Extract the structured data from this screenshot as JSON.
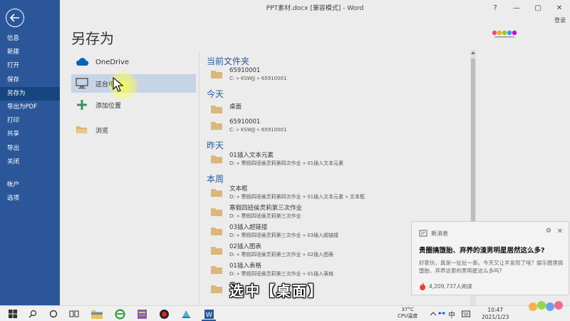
{
  "window": {
    "title": "PPT素材.docx [兼容模式] - Word",
    "controls": [
      "?",
      "—",
      "▢",
      "✕"
    ],
    "login": "登录"
  },
  "sidebar": {
    "items": [
      {
        "label": "信息"
      },
      {
        "label": "新建"
      },
      {
        "label": "打开"
      },
      {
        "label": "保存"
      },
      {
        "label": "另存为",
        "active": true
      },
      {
        "label": "导出为PDF"
      },
      {
        "label": "打印"
      },
      {
        "label": "共享"
      },
      {
        "label": "导出"
      },
      {
        "label": "关闭"
      },
      {
        "label": "帐户"
      },
      {
        "label": "选项"
      }
    ]
  },
  "page": {
    "title": "另存为"
  },
  "locations": [
    {
      "label": "OneDrive",
      "icon": "cloud-icon"
    },
    {
      "label": "这台电脑",
      "icon": "computer-icon",
      "selected": true
    },
    {
      "label": "添加位置",
      "icon": "plus-icon"
    },
    {
      "label": "浏览",
      "icon": "folder-open-icon"
    }
  ],
  "recent": {
    "sections": [
      {
        "title": "当前文件夹",
        "entries": [
          {
            "name": "65910001",
            "path": "C: » KSWJJ » 65910001"
          }
        ]
      },
      {
        "title": "今天",
        "entries": [
          {
            "name": "桌面",
            "path": ""
          },
          {
            "name": "65910001",
            "path": "C: » KSWJJ » 65910001"
          }
        ]
      },
      {
        "title": "昨天",
        "entries": [
          {
            "name": "01插入文本元素",
            "path": "D: » 寒假四班侯灵莉第四次作业 » 01插入文本元素"
          }
        ]
      },
      {
        "title": "本周",
        "entries": [
          {
            "name": "文本框",
            "path": "D: » 寒假四班侯灵莉第四次作业 » 01插入文本元素 » 文本框"
          },
          {
            "name": "寒假四班侯灵莉第三次作业",
            "path": "D: » 寒假四班侯灵莉第三次作业"
          },
          {
            "name": "03插入超链接",
            "path": "D: » 寒假四班侯灵莉第三次作业 » 03插入超链接"
          },
          {
            "name": "02插入图表",
            "path": "D: » 寒假四班侯灵莉第三次作业 » 02插入图表"
          },
          {
            "name": "01插入表格",
            "path": "D: » 寒假四班侯灵莉第三次作业 » 01插入表格"
          },
          {
            "name": "寒",
            "path": ""
          }
        ]
      }
    ]
  },
  "notification": {
    "source": "新消息",
    "title": "贵圈搞堕胎、弃养的渣男明星居然这么多?",
    "body": "好家伙，真是一扯扯一串。今天又让羊发现了啥？娱乐圈里搞堕胎、弃养这套的男明星这么多吗?",
    "reads": "4,209,737人阅读"
  },
  "caption": "选中【桌面】",
  "taskbar": {
    "temp": "37°C",
    "temp_label": "CPU温度",
    "ime": "中",
    "time": "10:47",
    "date": "2021/1/23"
  },
  "colors": {
    "sidebar": "#2b579a",
    "sidebar_active": "#174580",
    "accent": "#2b579a",
    "selected_location": "#c7d3e6",
    "folder": "#dcb67a"
  }
}
